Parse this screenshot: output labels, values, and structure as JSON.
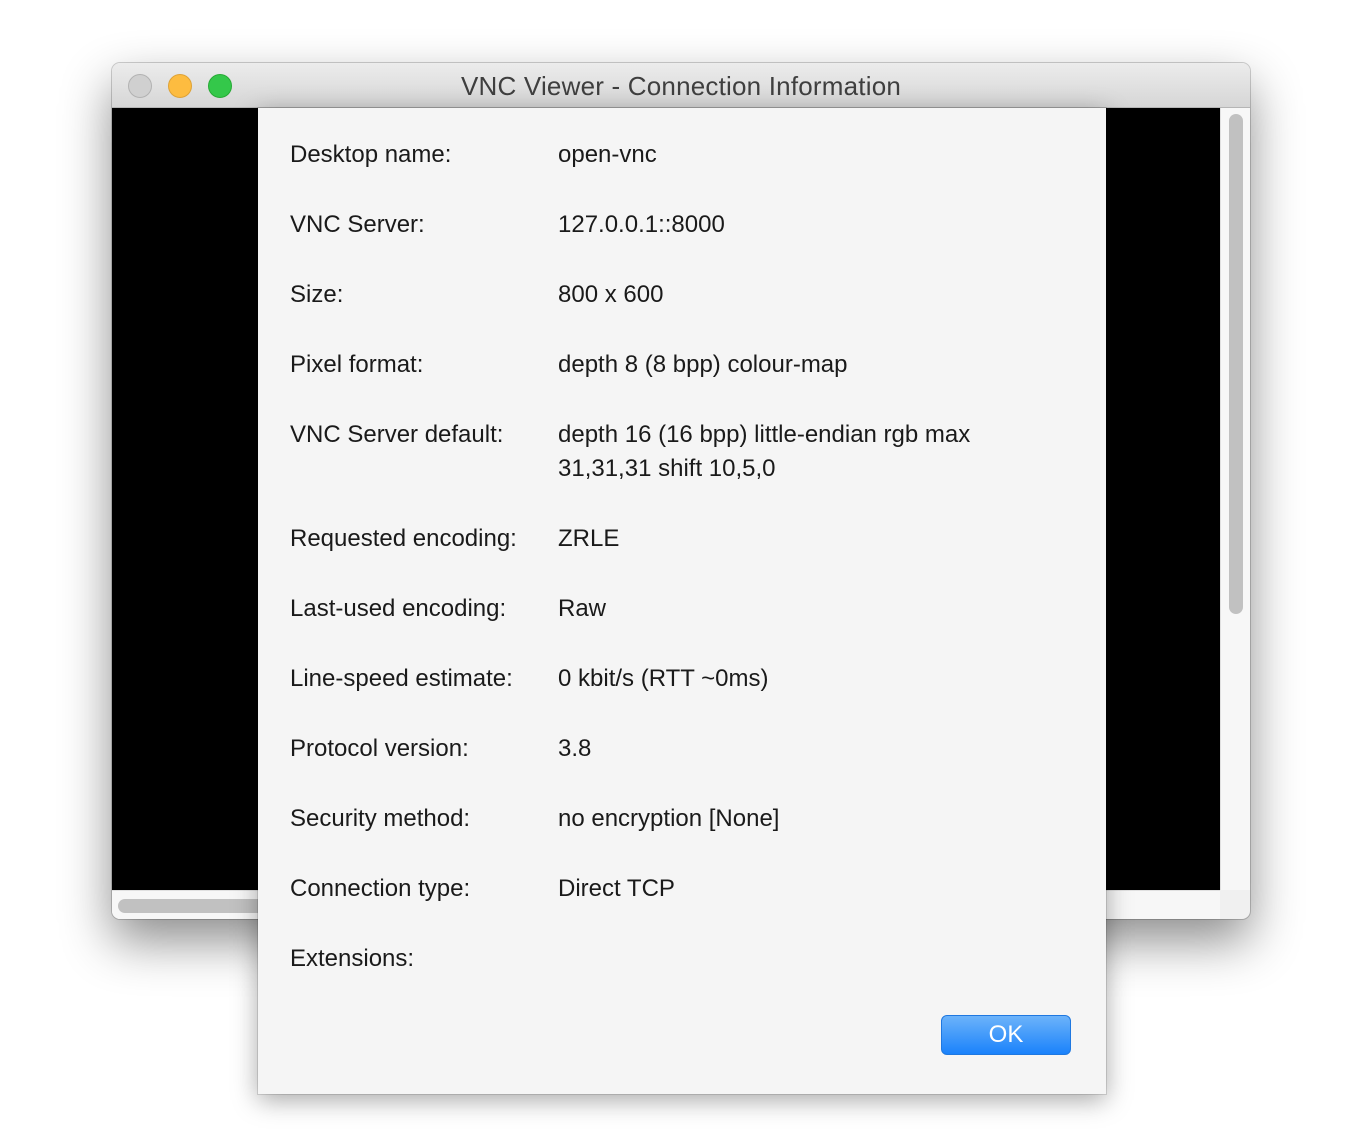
{
  "window": {
    "title": "VNC Viewer - Connection Information"
  },
  "info": {
    "rows": [
      {
        "label": "Desktop name:",
        "value": "open-vnc"
      },
      {
        "label": "VNC Server:",
        "value": "127.0.0.1::8000"
      },
      {
        "label": "Size:",
        "value": "800 x 600"
      },
      {
        "label": "Pixel format:",
        "value": "depth 8 (8 bpp) colour-map"
      },
      {
        "label": "VNC Server default:",
        "value": "depth 16 (16 bpp) little-endian rgb max 31,31,31 shift 10,5,0"
      },
      {
        "label": "Requested encoding:",
        "value": "ZRLE"
      },
      {
        "label": "Last-used encoding:",
        "value": "Raw"
      },
      {
        "label": "Line-speed estimate:",
        "value": "0 kbit/s (RTT ~0ms)"
      },
      {
        "label": "Protocol version:",
        "value": "3.8"
      },
      {
        "label": "Security method:",
        "value": "no encryption [None]"
      },
      {
        "label": "Connection type:",
        "value": "Direct TCP"
      },
      {
        "label": "Extensions:",
        "value": ""
      }
    ]
  },
  "buttons": {
    "ok_label": "OK"
  },
  "colors": {
    "accent": "#1a82fb",
    "close": "#d0d0d0",
    "minimize": "#fdbc40",
    "maximize": "#34c84a"
  }
}
